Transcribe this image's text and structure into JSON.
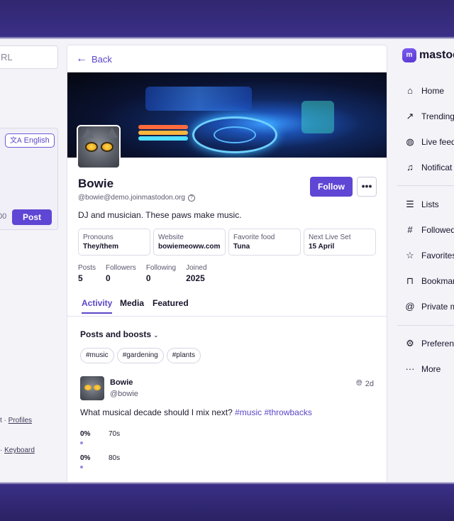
{
  "left": {
    "search_placeholder": "RL",
    "compose": {
      "language": "English",
      "char_count": "00",
      "post_label": "Post"
    },
    "footer": {
      "line1_prefix": "t · ",
      "line1_link": "Profiles",
      "line2_prefix": "· ",
      "line2_link": "Keyboard"
    }
  },
  "center": {
    "back_label": "Back",
    "profile": {
      "name": "Bowie",
      "handle": "@bowie@demo.joinmastodon.org",
      "follow_label": "Follow",
      "more_label": "•••",
      "bio": "DJ and musician. These paws make music.",
      "fields": [
        {
          "key": "Pronouns",
          "value": "They/them"
        },
        {
          "key": "Website",
          "value": "bowiemeoww.com"
        },
        {
          "key": "Favorite food",
          "value": "Tuna"
        },
        {
          "key": "Next Live Set",
          "value": "15 April"
        }
      ],
      "stats": [
        {
          "key": "Posts",
          "value": "5"
        },
        {
          "key": "Followers",
          "value": "0"
        },
        {
          "key": "Following",
          "value": "0"
        },
        {
          "key": "Joined",
          "value": "2025"
        }
      ]
    },
    "tabs": [
      "Activity",
      "Media",
      "Featured"
    ],
    "active_tab": "Activity",
    "filter_label": "Posts and boosts",
    "tag_chips": [
      "#music",
      "#gardening",
      "#plants"
    ],
    "status": {
      "author": "Bowie",
      "handle": "@bowie",
      "time": "2d",
      "text_prefix": "What musical decade should I mix next? ",
      "tag1": "#music",
      "tag2": "#throwbacks",
      "poll": [
        {
          "percent": "0%",
          "label": "70s"
        },
        {
          "percent": "0%",
          "label": "80s"
        }
      ]
    }
  },
  "right": {
    "brand": "mastodo",
    "nav_primary": [
      {
        "label": "Home",
        "icon": "home-icon"
      },
      {
        "label": "Trending",
        "icon": "trending-icon"
      },
      {
        "label": "Live feed",
        "icon": "globe-icon"
      },
      {
        "label": "Notificat",
        "icon": "bell-icon"
      }
    ],
    "nav_secondary": [
      {
        "label": "Lists",
        "icon": "list-icon"
      },
      {
        "label": "Followed",
        "icon": "hash-icon"
      },
      {
        "label": "Favorites",
        "icon": "star-icon"
      },
      {
        "label": "Bookmar",
        "icon": "bookmark-icon"
      },
      {
        "label": "Private m",
        "icon": "at-icon"
      }
    ],
    "nav_tertiary": [
      {
        "label": "Preferenc",
        "icon": "gear-icon"
      },
      {
        "label": "More",
        "icon": "ellipsis-icon"
      }
    ]
  },
  "colors": {
    "accent": "#5f46d4",
    "frame": "#302770"
  }
}
